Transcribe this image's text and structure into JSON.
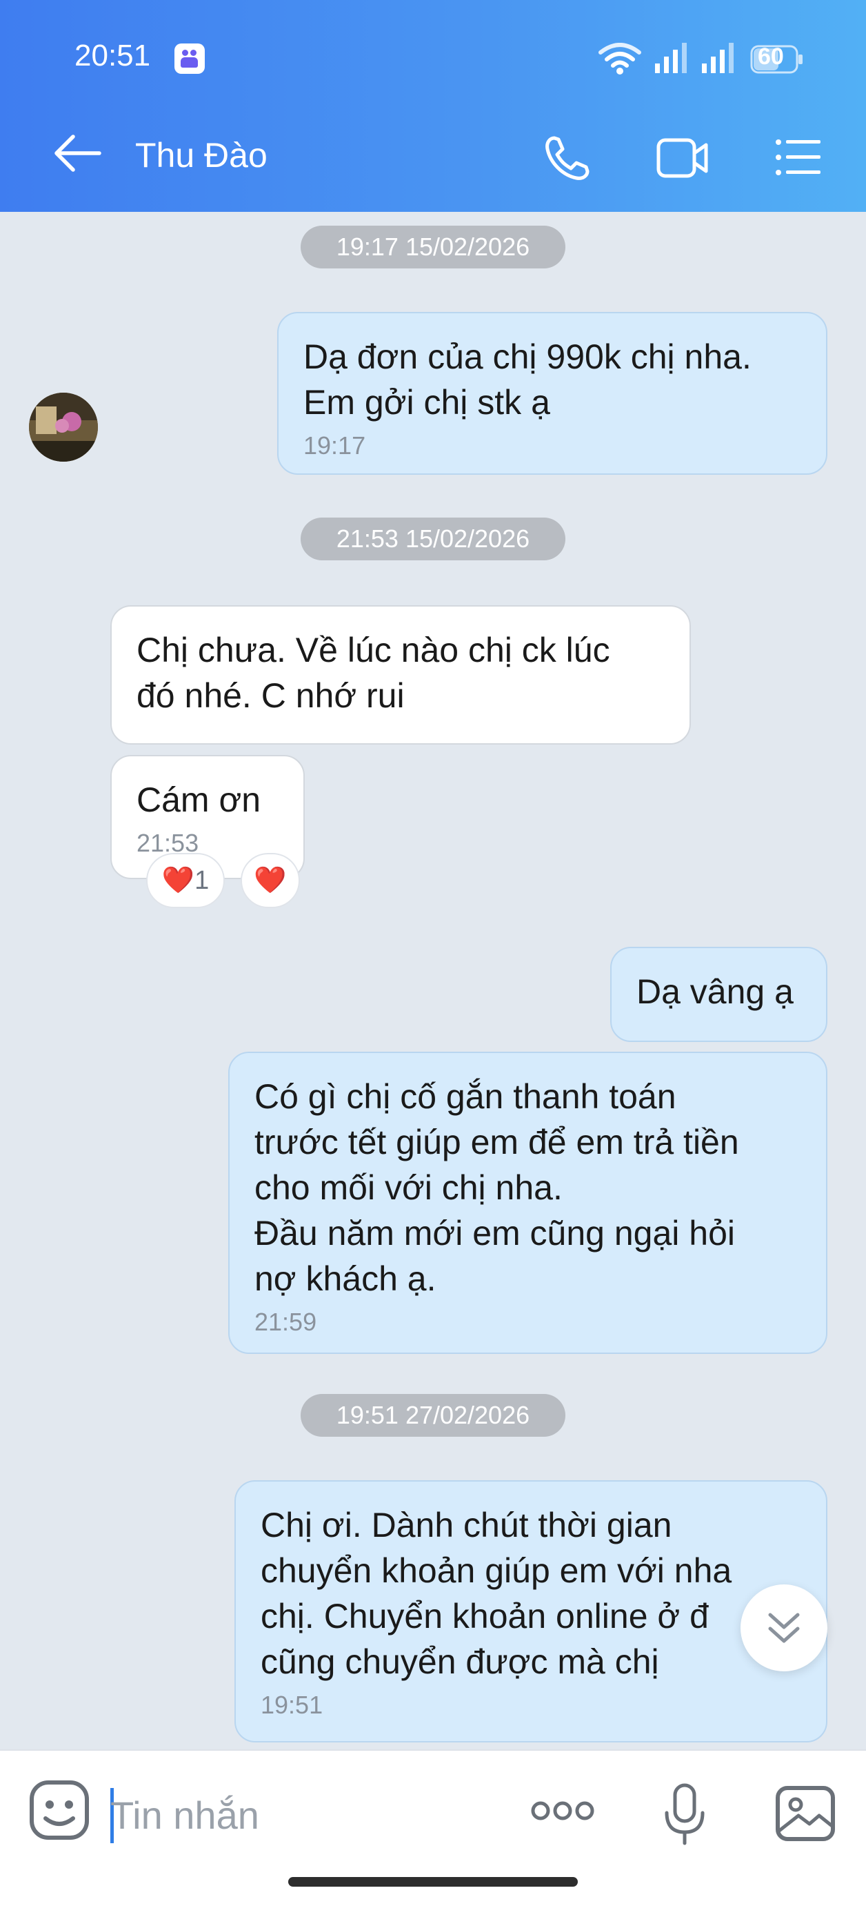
{
  "status_bar": {
    "time": "20:51",
    "battery": "60"
  },
  "header": {
    "contact_name": "Thu Đào"
  },
  "messages": [
    {
      "type": "date",
      "text": "19:17 15/02/2026"
    },
    {
      "type": "out",
      "text": "Dạ đơn của chị 990k chị nha.\nEm gởi chị stk ạ",
      "time": "19:17"
    },
    {
      "type": "date",
      "text": "21:53 15/02/2026"
    },
    {
      "type": "in",
      "text": "Chị chưa. Về lúc nào chị ck lúc\nđó nhé. C nhớ rui"
    },
    {
      "type": "in",
      "text": "Cám ơn",
      "time": "21:53",
      "reactions": [
        {
          "emoji": "❤️",
          "count": "1"
        },
        {
          "emoji": "❤️"
        }
      ]
    },
    {
      "type": "out",
      "text": "Dạ vâng ạ"
    },
    {
      "type": "out",
      "text": "Có gì chị cố gắn thanh toán\ntrước tết giúp em để em trả tiền\ncho mối với chị nha.\nĐầu năm mới em cũng ngại hỏi\nnợ khách ạ.",
      "time": "21:59"
    },
    {
      "type": "date",
      "text": "19:51 27/02/2026"
    },
    {
      "type": "out",
      "text": "Chị ơi. Dành chút thời gian\nchuyển khoản giúp em với nha\nchị. Chuyển khoản online ở đ\ncũng chuyển được mà chị",
      "time": "19:51"
    }
  ],
  "input": {
    "placeholder": "Tin nhắn"
  },
  "icons": [
    "back-arrow-icon",
    "phone-icon",
    "video-camera-icon",
    "menu-list-icon",
    "emoji-icon",
    "more-icon",
    "microphone-icon",
    "image-icon",
    "double-chevron-down-icon"
  ],
  "colors": {
    "header_start": "#3f7df0",
    "header_end": "#52b0f5",
    "outgoing_bubble": "#d6ebfc",
    "incoming_bubble": "#ffffff",
    "chat_bg": "#e2e8ef"
  }
}
